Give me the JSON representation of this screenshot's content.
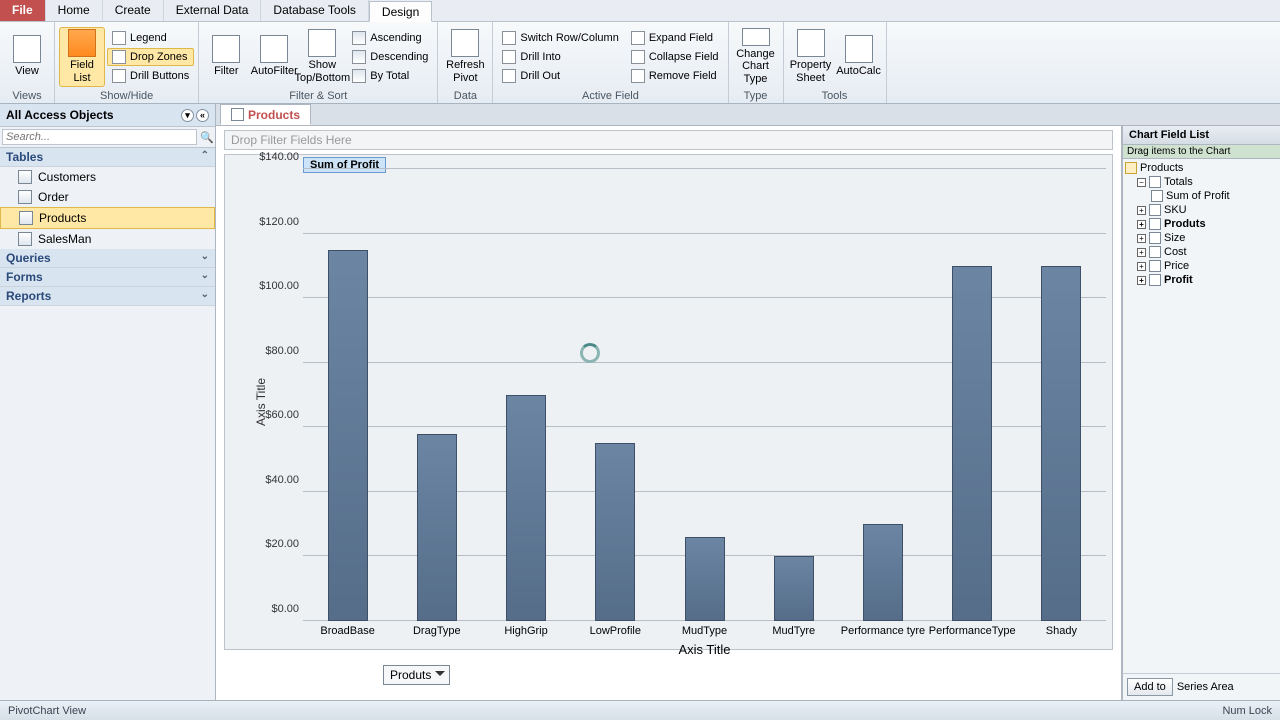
{
  "tabs": [
    "File",
    "Home",
    "Create",
    "External Data",
    "Database Tools",
    "Design"
  ],
  "active_tab": "Design",
  "ribbon": {
    "views": {
      "view": "View",
      "group": "Views"
    },
    "showhide": {
      "fieldlist": "Field List",
      "dropzones": "Drop Zones",
      "legend": "Legend",
      "drillbuttons": "Drill Buttons",
      "group": "Show/Hide"
    },
    "filtersort": {
      "filter": "Filter",
      "autofilter": "AutoFilter",
      "showtopbottom": "Show Top/Bottom",
      "ascending": "Ascending",
      "descending": "Descending",
      "bytotal": "By Total",
      "group": "Filter & Sort"
    },
    "data": {
      "refresh": "Refresh Pivot",
      "group": "Data"
    },
    "activefield": {
      "switch": "Switch Row/Column",
      "drillinto": "Drill Into",
      "drillout": "Drill Out",
      "expand": "Expand Field",
      "collapse": "Collapse Field",
      "remove": "Remove Field",
      "group": "Active Field"
    },
    "type": {
      "change": "Change Chart Type",
      "group": "Type"
    },
    "tools": {
      "propsheet": "Property Sheet",
      "autocalc": "AutoCalc",
      "group": "Tools"
    }
  },
  "nav": {
    "header": "All Access Objects",
    "search_ph": "Search...",
    "cats": {
      "tables": "Tables",
      "queries": "Queries",
      "forms": "Forms",
      "reports": "Reports"
    },
    "tables": [
      "Customers",
      "Order",
      "Products",
      "SalesMan"
    ],
    "selected": "Products"
  },
  "doc": {
    "tab": "Products",
    "filter_drop": "Drop Filter Fields Here",
    "legend": "Sum of Profit",
    "yaxis_title": "Axis Title",
    "xaxis_title": "Axis Title",
    "dropdown": "Produts"
  },
  "chart_data": {
    "type": "bar",
    "title": "Sum of Profit",
    "xlabel": "Axis Title",
    "ylabel": "Axis Title",
    "ylim": [
      0,
      140
    ],
    "yticks": [
      "$0.00",
      "$20.00",
      "$40.00",
      "$60.00",
      "$80.00",
      "$100.00",
      "$120.00",
      "$140.00"
    ],
    "categories": [
      "BroadBase",
      "DragType",
      "HighGrip",
      "LowProfile",
      "MudType",
      "MudTyre",
      "Performance tyre",
      "PerformanceType",
      "Shady"
    ],
    "values": [
      115,
      58,
      70,
      55,
      26,
      20,
      30,
      110,
      110
    ]
  },
  "fieldlist": {
    "title": "Chart Field List",
    "subtitle": "Drag items to the Chart",
    "root": "Products",
    "totals": "Totals",
    "sumprofit": "Sum of Profit",
    "fields": [
      "SKU",
      "Produts",
      "Size",
      "Cost",
      "Price",
      "Profit"
    ],
    "bold_fields": [
      "Produts",
      "Profit"
    ],
    "addto": "Add to",
    "series": "Series Area"
  },
  "status": {
    "left": "PivotChart View",
    "right": "Num Lock"
  },
  "colors": {
    "bar": "#5d7693",
    "accent": "#c1504e"
  }
}
